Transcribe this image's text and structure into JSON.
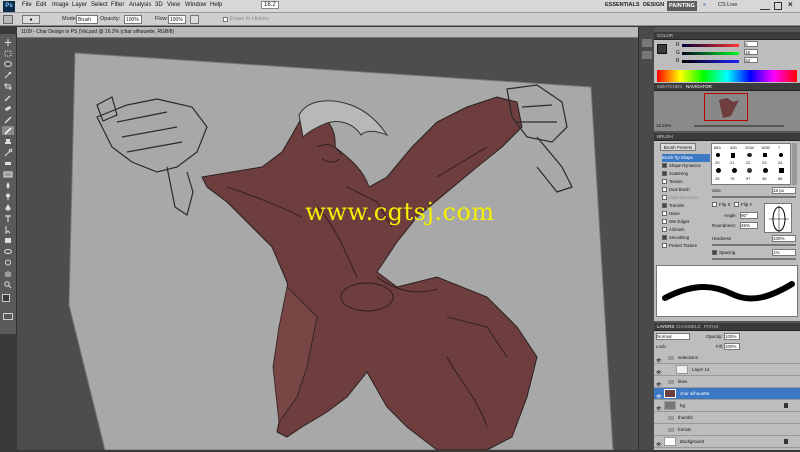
{
  "menu": {
    "items": [
      "File",
      "Edit",
      "Image",
      "Layer",
      "Select",
      "Filter",
      "Analysis",
      "3D",
      "View",
      "Window",
      "Help"
    ],
    "zoom": "16.2",
    "workspaces": [
      "ESSENTIALS",
      "DESIGN",
      "PAINTING"
    ],
    "cslive": "CS Live"
  },
  "options": {
    "mode_label": "Mode:",
    "mode_value": "Brush",
    "opacity_label": "Opacity:",
    "opacity_value": "100%",
    "flow_label": "Flow:",
    "flow_value": "100%",
    "erase_label": "Erase to History"
  },
  "document": {
    "tab_title": "1109 - Char Design in PS (VeLpsd @ 16.2% (char silhouette, RGB/8)"
  },
  "color_panel": {
    "title": "COLOR",
    "r": "0",
    "g": "19",
    "b": "33"
  },
  "navigator": {
    "tabs": [
      "SWATCHES",
      "NAVIGATOR"
    ],
    "zoom": "16.22%"
  },
  "brush_panel": {
    "title": "BRUSH",
    "presets_button": "Brush Presets",
    "options": [
      {
        "label": "Brush Tip Shape",
        "checked": false,
        "active": true
      },
      {
        "label": "Shape Dynamics",
        "checked": true
      },
      {
        "label": "Scattering",
        "checked": true
      },
      {
        "label": "Texture",
        "checked": false
      },
      {
        "label": "Dual Brush",
        "checked": false
      },
      {
        "label": "Color Dynamics",
        "checked": false
      },
      {
        "label": "Transfer",
        "checked": true
      },
      {
        "label": "Noise",
        "checked": false
      },
      {
        "label": "Wet Edges",
        "checked": false
      },
      {
        "label": "Airbrush",
        "checked": false
      },
      {
        "label": "Smoothing",
        "checked": true
      },
      {
        "label": "Protect Texture",
        "checked": false
      }
    ],
    "sizes_row1": [
      "883",
      "400",
      "2034",
      "1830",
      "7"
    ],
    "sizes_row2": [
      "20",
      "21",
      "22",
      "23",
      "24"
    ],
    "sizes_row3": [
      "25",
      "75",
      "97",
      "45",
      "86"
    ],
    "size_label": "Size",
    "size_value": "18 px",
    "flipx": "Flip X",
    "flipy": "Flip Y",
    "angle_label": "Angle:",
    "angle_value": "90°",
    "roundness_label": "Roundness:",
    "roundness_value": "45%",
    "hardness_label": "Hardness",
    "hardness_value": "100%",
    "spacing_label": "Spacing",
    "spacing_value": "1%"
  },
  "layers_panel": {
    "tabs": [
      "LAYERS",
      "CHANNELS",
      "PATHS"
    ],
    "blend": "Normal",
    "opacity_label": "Opacity:",
    "opacity_value": "100%",
    "lock_label": "Lock:",
    "fill_label": "Fill:",
    "fill_value": "100%",
    "layers": [
      {
        "name": "selections",
        "type": "group",
        "visible": true
      },
      {
        "name": "Layer 14",
        "type": "layer",
        "visible": true
      },
      {
        "name": "lines",
        "type": "group",
        "visible": true
      },
      {
        "name": "char silhouette",
        "type": "layer",
        "visible": true,
        "selected": true
      },
      {
        "name": "bg",
        "type": "layer",
        "visible": true
      },
      {
        "name": "thumbs",
        "type": "group",
        "visible": false
      },
      {
        "name": "format",
        "type": "group",
        "visible": false
      },
      {
        "name": "Background",
        "type": "layer",
        "visible": true
      }
    ]
  },
  "watermark": "www.cgtsj.com",
  "colors": {
    "silhouette": "#6e3d3d",
    "paper": "#aaaaaa",
    "canvas_bg": "#4d4d4d",
    "accent": "#3c79c4"
  }
}
